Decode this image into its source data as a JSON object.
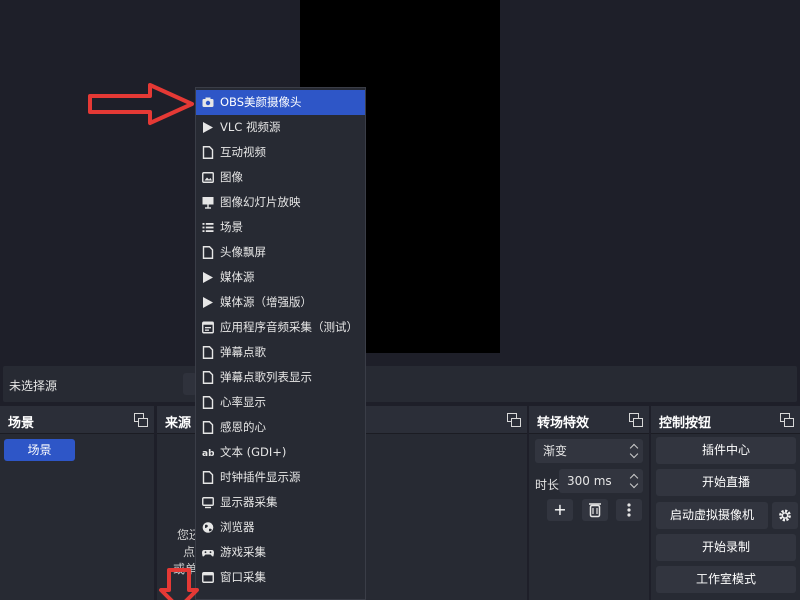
{
  "source_bar": {
    "label": "未选择源"
  },
  "docks": {
    "scenes": {
      "title": "场景",
      "items": [
        "场景"
      ]
    },
    "sources": {
      "title": "来源",
      "hint_lines": [
        "您还",
        "点",
        "或单"
      ]
    },
    "transitions": {
      "title": "转场特效",
      "transition_type": "渐变",
      "duration_label": "时长",
      "duration_value": "300 ms"
    },
    "controls": {
      "title": "控制按钮",
      "buttons": [
        "插件中心",
        "开始直播",
        "启动虚拟摄像机",
        "开始录制",
        "工作室模式"
      ]
    }
  },
  "context_menu": {
    "items": [
      {
        "label": "OBS美颜摄像头",
        "icon": "camera-icon",
        "selected": true
      },
      {
        "label": "VLC 视频源",
        "icon": "play-icon"
      },
      {
        "label": "互动视频",
        "icon": "file-icon"
      },
      {
        "label": "图像",
        "icon": "image-icon"
      },
      {
        "label": "图像幻灯片放映",
        "icon": "slideshow-icon"
      },
      {
        "label": "场景",
        "icon": "list-icon"
      },
      {
        "label": "头像飘屏",
        "icon": "file-icon"
      },
      {
        "label": "媒体源",
        "icon": "play-icon"
      },
      {
        "label": "媒体源（增强版）",
        "icon": "play-icon"
      },
      {
        "label": "应用程序音频采集（测试）",
        "icon": "app-audio-icon"
      },
      {
        "label": "弹幕点歌",
        "icon": "file-icon"
      },
      {
        "label": "弹幕点歌列表显示",
        "icon": "file-icon"
      },
      {
        "label": "心率显示",
        "icon": "file-icon"
      },
      {
        "label": "感恩的心",
        "icon": "file-icon"
      },
      {
        "label": "文本 (GDI+)",
        "icon": "text-icon"
      },
      {
        "label": "时钟插件显示源",
        "icon": "file-icon"
      },
      {
        "label": "显示器采集",
        "icon": "monitor-icon"
      },
      {
        "label": "浏览器",
        "icon": "globe-icon"
      },
      {
        "label": "游戏采集",
        "icon": "gamepad-icon"
      },
      {
        "label": "窗口采集",
        "icon": "window-icon"
      }
    ]
  },
  "colors": {
    "accent": "#2e56c7",
    "annotation_red": "#e53935",
    "panel": "#272a33",
    "background": "#1e1f29"
  }
}
